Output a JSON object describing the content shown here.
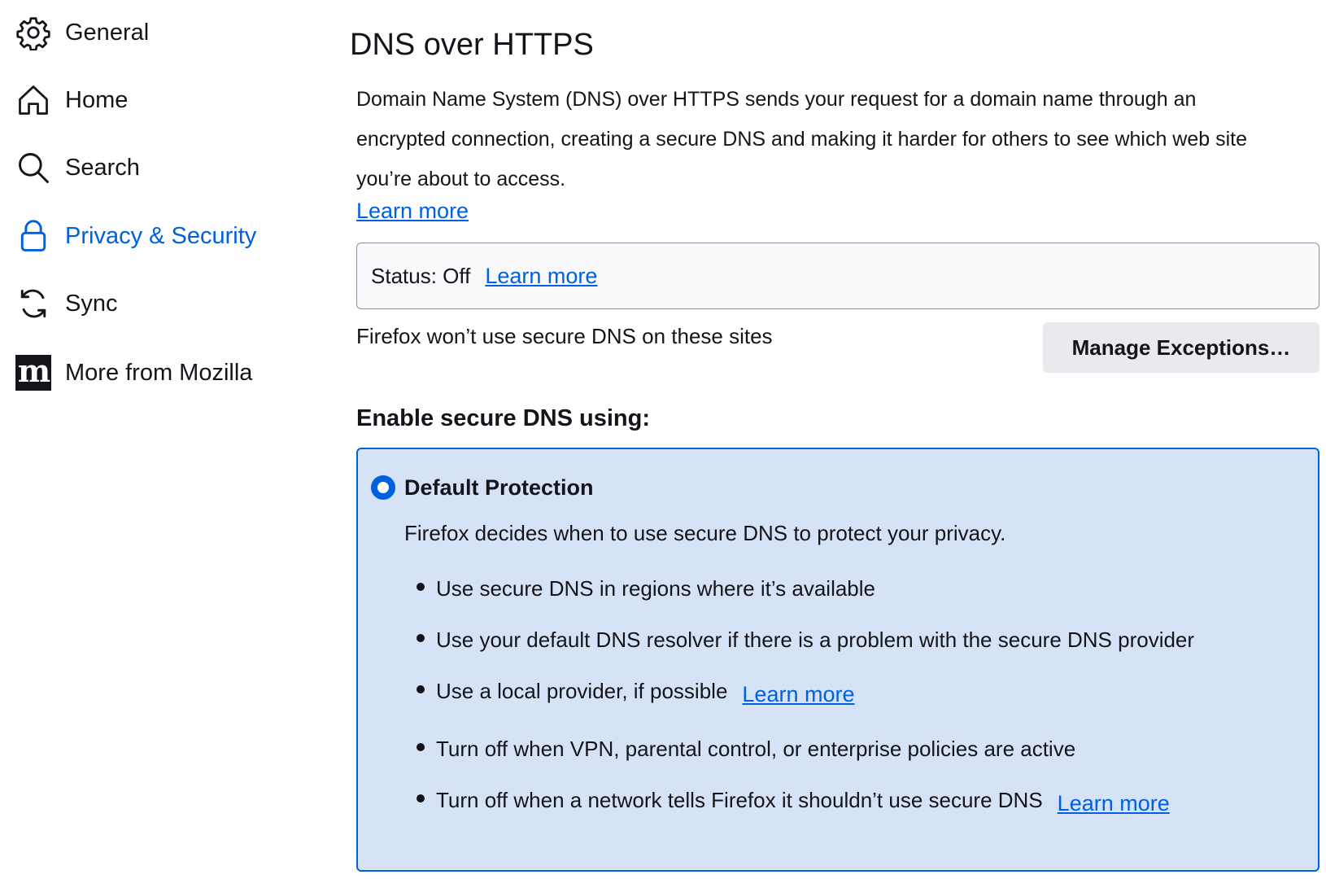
{
  "sidebar": {
    "items": [
      {
        "label": "General",
        "icon": "gear-icon"
      },
      {
        "label": "Home",
        "icon": "home-icon"
      },
      {
        "label": "Search",
        "icon": "search-icon"
      },
      {
        "label": "Privacy & Security",
        "icon": "lock-icon",
        "active": true
      },
      {
        "label": "Sync",
        "icon": "sync-icon"
      },
      {
        "label": "More from Mozilla",
        "icon": "mozilla-logo-icon",
        "logo_text": "m"
      }
    ]
  },
  "main": {
    "title": "DNS over HTTPS",
    "description": "Domain Name System (DNS) over HTTPS sends your request for a domain name through an encrypted connection, creating a secure DNS and making it harder for others to see which web site you’re about to access.",
    "learn_more": "Learn more",
    "status": {
      "label": "Status: Off",
      "learn_more": "Learn more"
    },
    "exceptions": {
      "label": "Firefox won’t use secure DNS on these sites",
      "button": "Manage Exceptions…"
    },
    "section_title": "Enable secure DNS using:",
    "option": {
      "title": "Default Protection",
      "description": "Firefox decides when to use secure DNS to protect your privacy.",
      "selected": true,
      "bullets": [
        {
          "text": "Use secure DNS in regions where it’s available"
        },
        {
          "text": "Use your default DNS resolver if there is a problem with the secure DNS provider"
        },
        {
          "text": "Use a local provider, if possible",
          "link": "Learn more"
        },
        {
          "text": "Turn off when VPN, parental control, or enterprise policies are active"
        },
        {
          "text": "Turn off when a network tells Firefox it shouldn’t use secure DNS",
          "link": "Learn more"
        }
      ]
    }
  },
  "colors": {
    "accent": "#0061e0",
    "card_bg": "#d6e3f7",
    "text": "#15141a",
    "button_bg": "#eaeaee"
  }
}
